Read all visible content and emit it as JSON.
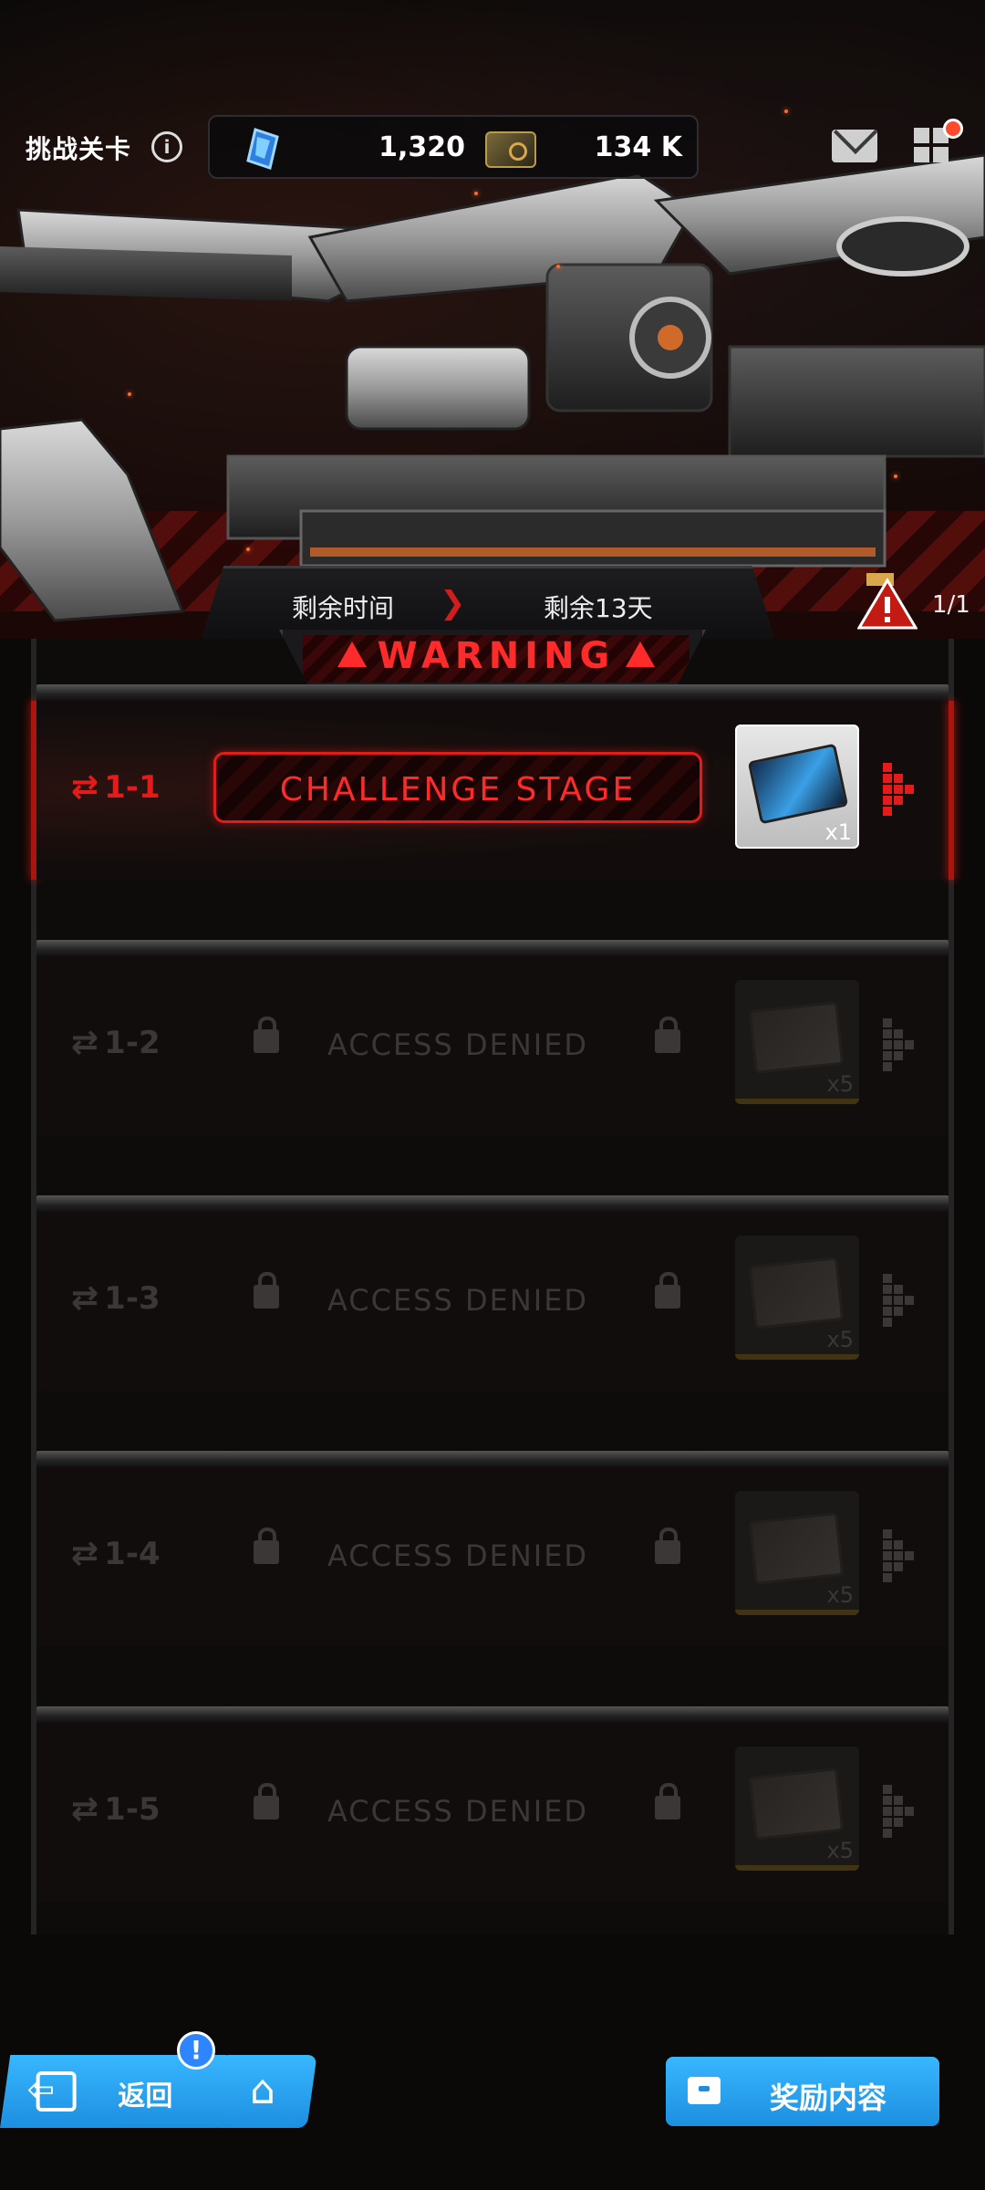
{
  "header": {
    "title": "挑战关卡",
    "gems": "1,320",
    "plus": "+",
    "coins": "134 K"
  },
  "timer": {
    "label": "剩余时间",
    "value": "剩余13天",
    "attempts": "1/1"
  },
  "warning_text": "WARNING",
  "stages": [
    {
      "number": "1-1",
      "status": "active",
      "action_label": "CHALLENGE STAGE",
      "reward_qty": "x1"
    },
    {
      "number": "1-2",
      "status": "locked",
      "action_label": "ACCESS DENIED",
      "reward_qty": "x5"
    },
    {
      "number": "1-3",
      "status": "locked",
      "action_label": "ACCESS DENIED",
      "reward_qty": "x5"
    },
    {
      "number": "1-4",
      "status": "locked",
      "action_label": "ACCESS DENIED",
      "reward_qty": "x5"
    },
    {
      "number": "1-5",
      "status": "locked",
      "action_label": "ACCESS DENIED",
      "reward_qty": "x5"
    }
  ],
  "footer": {
    "back_label": "返回",
    "back_badge": "!",
    "rewards_label": "奖励内容"
  },
  "icons": {
    "gem": "gem-icon",
    "coin": "coin-icon",
    "info": "info-icon",
    "mail": "mail-icon",
    "menu": "menu-grid-icon",
    "lock": "lock-icon",
    "loop": "repeat-icon",
    "back": "exit-icon",
    "home": "home-icon",
    "rewards": "chest-icon"
  },
  "colors": {
    "accent_red": "#e31b1b",
    "button_blue": "#2aa4f4",
    "locked_gray": "#3a3736"
  }
}
